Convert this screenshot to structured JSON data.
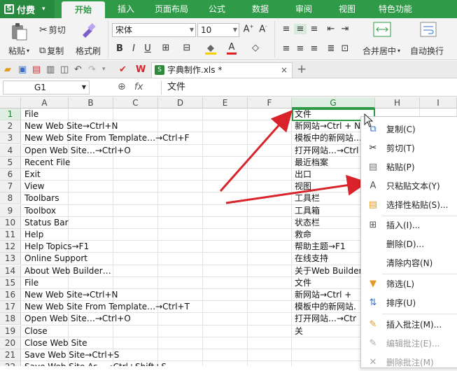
{
  "tabs": {
    "app": "付费",
    "items": [
      "开始",
      "插入",
      "页面布局",
      "公式",
      "数据",
      "审阅",
      "视图",
      "特色功能"
    ]
  },
  "ribbon": {
    "paste": "粘贴",
    "cut": "剪切",
    "copy": "复制",
    "format_painter": "格式刷",
    "font_name": "宋体",
    "font_size": "10",
    "merge_center": "合并居中",
    "wrap_text": "自动换行"
  },
  "document": {
    "tab_title": "字典制作.xls *"
  },
  "formula_bar": {
    "cell_ref": "G1",
    "fx": "fx",
    "content": "文件"
  },
  "columns": [
    "A",
    "B",
    "C",
    "D",
    "E",
    "F",
    "G",
    "H",
    "I"
  ],
  "rows": [
    {
      "n": "1",
      "a": "File",
      "g": "文件"
    },
    {
      "n": "2",
      "a": "New Web Site→Ctrl+N",
      "g": "新网站→Ctrl + N"
    },
    {
      "n": "3",
      "a": "New Web Site From Template…→Ctrl+F",
      "g": "模板中的新网站…→"
    },
    {
      "n": "4",
      "a": "Open Web Site…→Ctrl+O",
      "g": "打开网站…→Ctrl"
    },
    {
      "n": "5",
      "a": "Recent File",
      "g": "最近档案"
    },
    {
      "n": "6",
      "a": "Exit",
      "g": "出口"
    },
    {
      "n": "7",
      "a": "View",
      "g": "视图"
    },
    {
      "n": "8",
      "a": "Toolbars",
      "g": "工具栏"
    },
    {
      "n": "9",
      "a": "Toolbox",
      "g": "工具箱"
    },
    {
      "n": "10",
      "a": "Status Bar",
      "g": "状态栏"
    },
    {
      "n": "11",
      "a": "Help",
      "g": "救命"
    },
    {
      "n": "12",
      "a": "Help Topics→F1",
      "g": "帮助主题→F1"
    },
    {
      "n": "13",
      "a": "Online Support",
      "g": "在线支持"
    },
    {
      "n": "14",
      "a": "About Web Builder…",
      "g": "关于Web Builder"
    },
    {
      "n": "15",
      "a": "File",
      "g": "文件"
    },
    {
      "n": "16",
      "a": "New Web Site→Ctrl+N",
      "g": "新网站→Ctrl +"
    },
    {
      "n": "17",
      "a": "New Web Site From Template…→Ctrl+T",
      "g": "模板中的新网站."
    },
    {
      "n": "18",
      "a": "Open Web Site…→Ctrl+O",
      "g": "打开网站…→Ctr"
    },
    {
      "n": "19",
      "a": "Close",
      "g": "关"
    },
    {
      "n": "20",
      "a": "Close Web Site",
      "g": ""
    },
    {
      "n": "21",
      "a": "Save Web Site→Ctrl+S",
      "g": ""
    },
    {
      "n": "22",
      "a": "Save Web Site As…→Ctrl+Shift+S",
      "g": ""
    }
  ],
  "context_menu": {
    "copy": "复制(C)",
    "cut": "剪切(T)",
    "paste": "粘贴(P)",
    "paste_text_only": "只粘贴文本(Y)",
    "paste_special": "选择性粘贴(S)...",
    "insert": "插入(I)...",
    "delete": "删除(D)...",
    "clear_contents": "清除内容(N)",
    "filter": "筛选(L)",
    "sort": "排序(U)",
    "insert_comment": "插入批注(M)...",
    "edit_comment": "编辑批注(E)...",
    "delete_comment": "删除批注(M)"
  },
  "colors": {
    "brand_green": "#2f9a48",
    "arrow_red": "#d9232a",
    "selection_green": "#2e9a45"
  }
}
